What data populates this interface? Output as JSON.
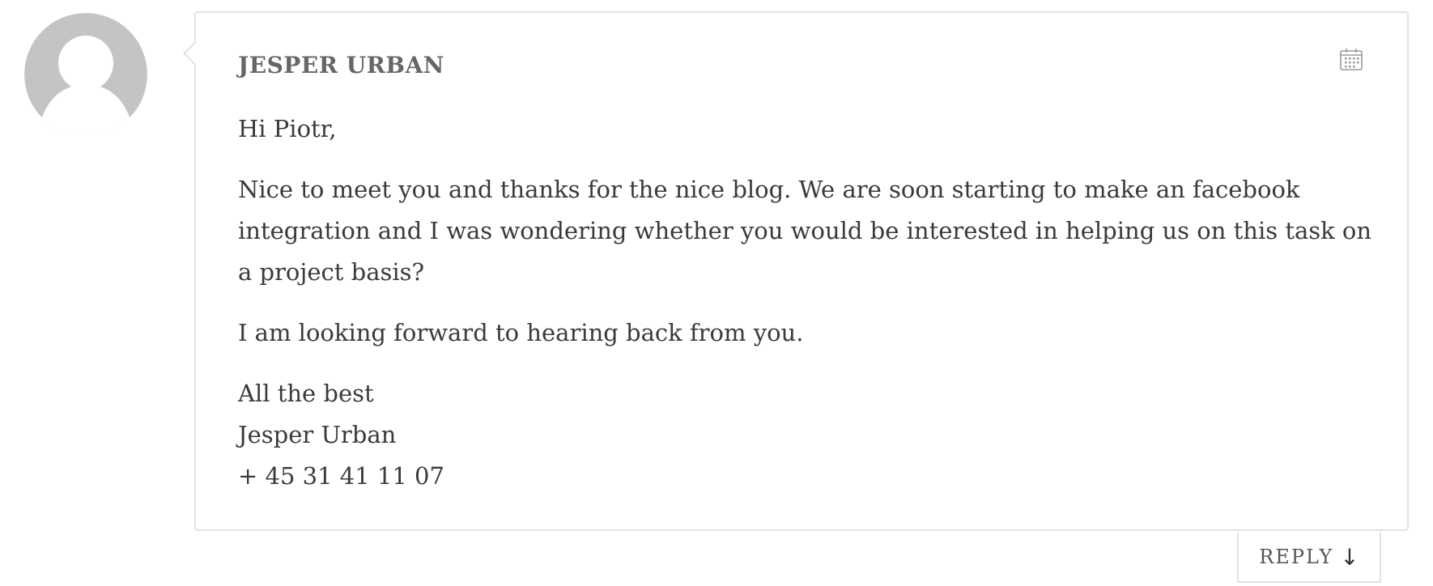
{
  "comment": {
    "author": "JESPER URBAN",
    "greeting": "Hi Piotr,",
    "paragraph_1": "Nice to meet you and thanks for the nice blog. We are soon starting to make an facebook integration and I was wondering whether you would be interested in helping us on this task on a project basis?",
    "paragraph_2": "I am looking forward to hearing back from you.",
    "signature": {
      "closing": "All the best",
      "name": "Jesper Urban",
      "phone": "+ 45 31 41 11 07"
    },
    "reply_label": "REPLY",
    "reply_arrow": "↓"
  },
  "icons": {
    "avatar": "default-user-avatar",
    "date": "calendar-icon"
  },
  "colors": {
    "border": "#e2e2e2",
    "avatar_gray": "#c4c4c4",
    "author_text": "#666666",
    "body_text": "#3a3a3a"
  }
}
